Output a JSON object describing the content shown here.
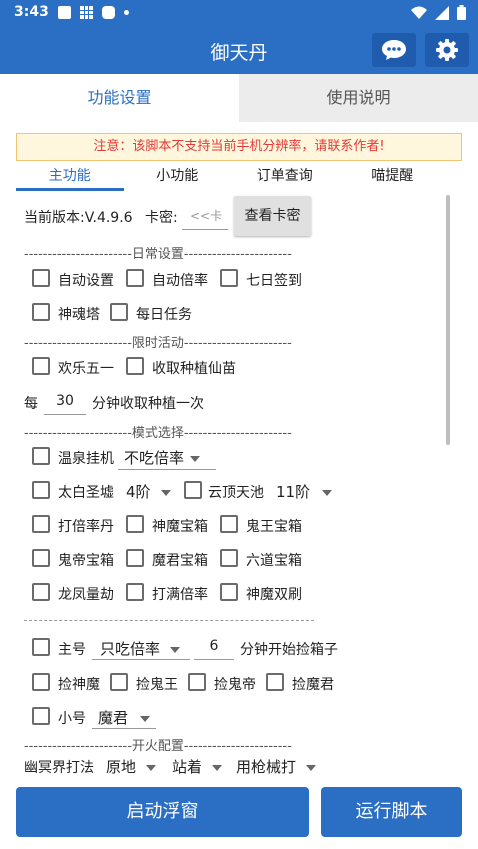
{
  "status_bar": {
    "time": "3:43"
  },
  "app": {
    "title": "御天丹"
  },
  "tabs": [
    {
      "label": "功能设置",
      "active": true
    },
    {
      "label": "使用说明",
      "active": false
    }
  ],
  "notice": "注意：该脚本不支持当前手机分辨率，请联系作者!",
  "subtabs": [
    {
      "label": "主功能",
      "active": true
    },
    {
      "label": "小功能",
      "active": false
    },
    {
      "label": "订单查询",
      "active": false
    },
    {
      "label": "喵提醒",
      "active": false
    }
  ],
  "version": {
    "label": "当前版本:V.4.9.6",
    "card_label": "卡密:",
    "card_placeholder": "<<卡",
    "check_button": "查看卡密"
  },
  "daily": {
    "header": "-----------------------日常设置-----------------------",
    "items": [
      "自动设置",
      "自动倍率",
      "七日签到",
      "神魂塔",
      "每日任务"
    ]
  },
  "limited": {
    "header": "-----------------------限时活动-----------------------",
    "items": [
      "欢乐五一",
      "收取种植仙苗"
    ],
    "interval_prefix": "每",
    "interval_value": "30",
    "interval_suffix": "分钟收取种植一次"
  },
  "mode": {
    "header": "-----------------------模式选择-----------------------",
    "hot_spring": "温泉挂机",
    "hot_spring_select": "不吃倍率",
    "taibai": "太白圣墟",
    "taibai_select": "4阶",
    "yunding": "云顶天池",
    "yunding_select": "11阶",
    "items_row3": [
      "打倍率丹",
      "神魔宝箱",
      "鬼王宝箱"
    ],
    "items_row4": [
      "鬼帝宝箱",
      "魔君宝箱",
      "六道宝箱"
    ],
    "items_row5": [
      "龙凤量劫",
      "打满倍率",
      "神魔双刷"
    ]
  },
  "account": {
    "main": "主号",
    "main_select": "只吃倍率",
    "minutes_value": "6",
    "minutes_suffix": "分钟开始捡箱子",
    "pick_items": [
      "捡神魔",
      "捡鬼王",
      "捡鬼帝",
      "捡魔君"
    ],
    "alt": "小号",
    "alt_select": "魔君"
  },
  "fire": {
    "header": "-----------------------开火配置-----------------------",
    "label": "幽冥界打法",
    "select1": "原地",
    "select2": "站着",
    "select3": "用枪械打"
  },
  "buttons": {
    "float": "启动浮窗",
    "run": "运行脚本"
  },
  "colors": {
    "primary": "#2b6fc4",
    "notice_text": "#e53935"
  }
}
